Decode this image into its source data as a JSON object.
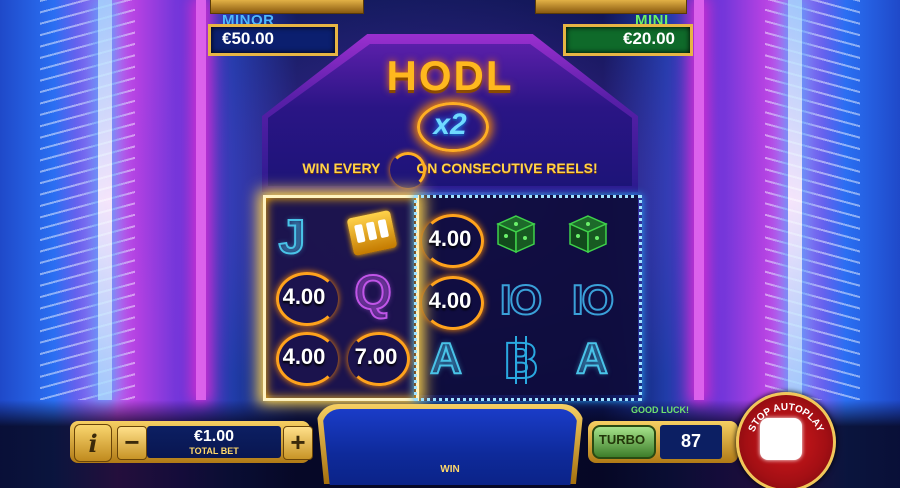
{
  "jackpots": {
    "minor": {
      "label": "MINOR",
      "value": "€50.00",
      "label_color": "#4fb7ff",
      "box_color": "#0b1f6f"
    },
    "mini": {
      "label": "MINI",
      "value": "€20.00",
      "label_color": "#6bf06b",
      "box_color": "#0f6a2a"
    }
  },
  "feature": {
    "title": "HODL",
    "multiplier": "x2",
    "rule_before": "WIN EVERY",
    "rule_icon": "coin-icon",
    "rule_after": "ON CONSECUTIVE REELS!"
  },
  "reels": {
    "left": {
      "symbols": [
        {
          "type": "letter",
          "text": "J"
        },
        {
          "type": "slot-machine-icon"
        },
        {
          "type": "coin",
          "text": "4.00"
        },
        {
          "type": "letter",
          "text": "Q"
        },
        {
          "type": "coin",
          "text": "4.00"
        },
        {
          "type": "coin",
          "text": "7.00"
        }
      ]
    },
    "right": {
      "symbols": [
        {
          "type": "coin",
          "text": "4.00"
        },
        {
          "type": "dice-icon"
        },
        {
          "type": "dice-icon"
        },
        {
          "type": "coin",
          "text": "4.00"
        },
        {
          "type": "ten",
          "text": "IO"
        },
        {
          "type": "ten",
          "text": "IO"
        },
        {
          "type": "letter",
          "text": "A"
        },
        {
          "type": "bitcoin-icon"
        },
        {
          "type": "letter",
          "text": "A"
        }
      ]
    }
  },
  "controls": {
    "info": "i",
    "minus": "−",
    "plus": "+",
    "bet_value": "€1.00",
    "bet_label": "TOTAL BET",
    "win_label": "WIN",
    "status": "GOOD LUCK!",
    "turbo": "TURBO",
    "spins_left": "87",
    "stop_autoplay": "STOP AUTOPLAY"
  },
  "colors": {
    "gold": "#f6cf63",
    "reel_glow": "#ffd54a",
    "stop_red": "#d3181c"
  }
}
